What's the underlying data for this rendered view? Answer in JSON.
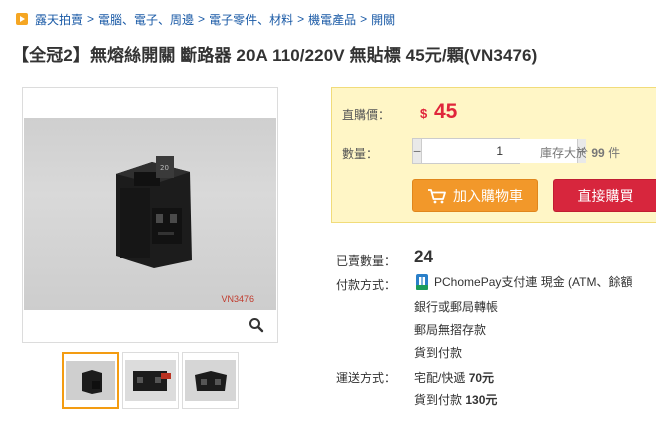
{
  "breadcrumb": {
    "items": [
      "露天拍賣",
      "電腦、電子、周邊",
      "電子零件、材料",
      "機電產品",
      "開關"
    ],
    "separator": ">"
  },
  "product": {
    "title": "【全冠2】無熔絲開關 斷路器 20A 110/220V 無貼標 45元/顆(VN3476)",
    "watermark": "VN3476"
  },
  "gallery": {
    "thumbnails": 3,
    "active_index": 0
  },
  "purchase": {
    "price_label": "直購價：",
    "currency_symbol": "$",
    "price": "45",
    "quantity_label": "數量：",
    "quantity_value": "1",
    "minus": "−",
    "plus": "+",
    "stock_prefix": "庫存大於",
    "stock_count": "99",
    "stock_unit": "件",
    "add_to_cart": "加入購物車",
    "buy_now": "直接購買"
  },
  "details": {
    "sold_label": "已賣數量：",
    "sold_count": "24",
    "payment_label": "付款方式：",
    "payment_pchome": "PChomePay支付連 現金 (ATM、餘額",
    "payment_bank": "銀行或郵局轉帳",
    "payment_postal": "郵局無摺存款",
    "payment_cod": "貨到付款",
    "shipping_label": "運送方式：",
    "shipping_home_label": "宅配/快遞",
    "shipping_home_price": "70元",
    "shipping_cod_label": "貨到付款",
    "shipping_cod_price": "130元"
  },
  "colors": {
    "link": "#1a5aa6",
    "price": "#e0263b",
    "cart_button": "#f2982a",
    "buy_button": "#d7263d",
    "buy_box_bg": "#fff6c6",
    "active_thumb_border": "#f39c12"
  }
}
